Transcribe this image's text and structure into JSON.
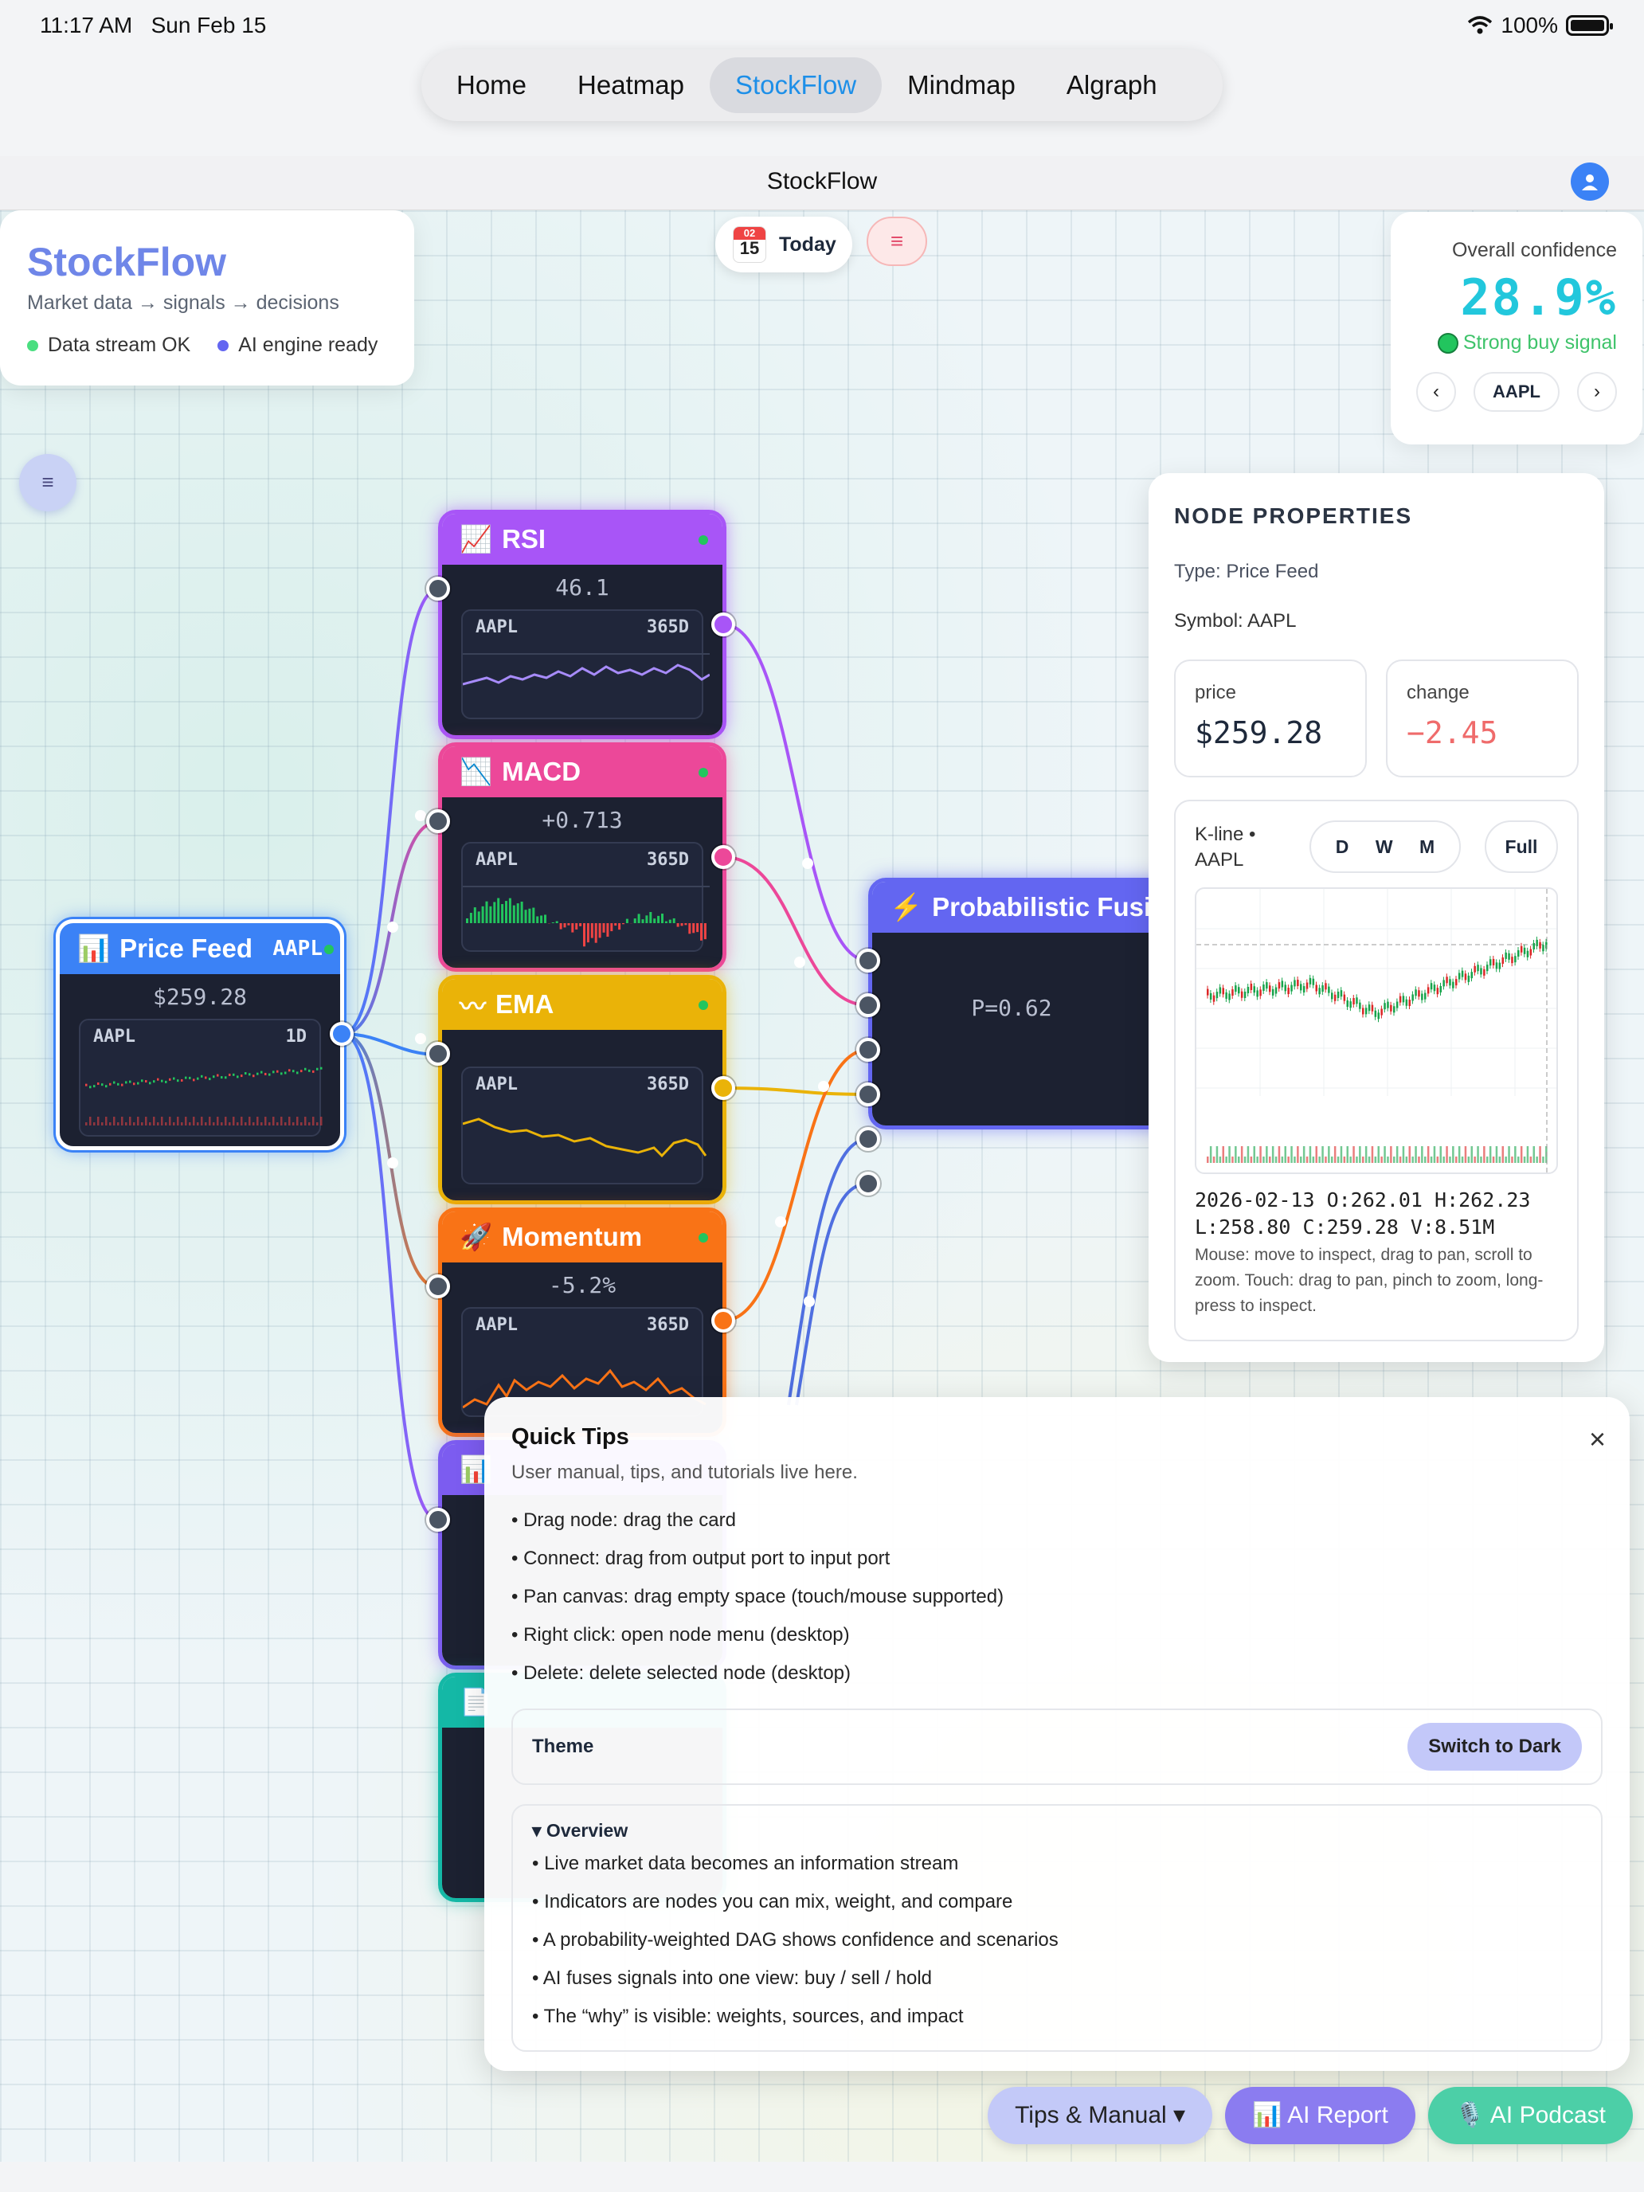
{
  "status": {
    "time": "11:17 AM",
    "date": "Sun Feb 15",
    "battery": "100%"
  },
  "nav": {
    "tabs": [
      "Home",
      "Heatmap",
      "StockFlow",
      "Mindmap",
      "Algraph"
    ],
    "active": "StockFlow"
  },
  "page_title": "StockFlow",
  "brand": {
    "name": "StockFlow",
    "tagline": "Market data → signals → decisions",
    "status_data": "Data stream OK",
    "status_ai": "AI engine ready"
  },
  "date_pill": {
    "month": "02",
    "day": "15",
    "label": "Today"
  },
  "confidence": {
    "label": "Overall confidence",
    "value": "28.9%",
    "signal": "Strong buy signal",
    "ticker": "AAPL",
    "prev": "‹",
    "next": "›"
  },
  "nodes": {
    "price_feed": {
      "icon": "📊",
      "title": "Price Feed",
      "symbol": "AAPL",
      "value": "$259.28",
      "chart_left": "AAPL",
      "chart_right": "1D"
    },
    "rsi": {
      "icon": "📈",
      "title": "RSI",
      "value": "46.1",
      "chart_left": "AAPL",
      "chart_right": "365D"
    },
    "macd": {
      "icon": "📉",
      "title": "MACD",
      "value": "+0.713",
      "chart_left": "AAPL",
      "chart_right": "365D"
    },
    "ema": {
      "icon": "〰",
      "title": "EMA",
      "chart_left": "AAPL",
      "chart_right": "365D"
    },
    "momentum": {
      "icon": "🚀",
      "title": "Momentum",
      "value": "-5.2%",
      "chart_left": "AAPL",
      "chart_right": "365D"
    },
    "fusion": {
      "icon": "⚡",
      "title": "Probabilistic Fusion",
      "value": "P=0.62"
    }
  },
  "properties": {
    "title": "NODE PROPERTIES",
    "type_label": "Type: Price Feed",
    "symbol_label": "Symbol: AAPL",
    "price_label": "price",
    "price_value": "$259.28",
    "change_label": "change",
    "change_value": "−2.45",
    "kline_title": "K-line • AAPL",
    "periods": [
      "D",
      "W",
      "M"
    ],
    "full_label": "Full",
    "ohlc_line1": "2026-02-13  O:262.01 H:262.23",
    "ohlc_line2": "L:258.80 C:259.28  V:8.51M",
    "hint": "Mouse: move to inspect, drag to pan, scroll to zoom. Touch: drag to pan, pinch to zoom, long-press to inspect."
  },
  "tips": {
    "title": "Quick Tips",
    "subtitle": "User manual, tips, and tutorials live here.",
    "items": [
      "Drag node: drag the card",
      "Connect: drag from output port to input port",
      "Pan canvas: drag empty space (touch/mouse supported)",
      "Right click: open node menu (desktop)",
      "Delete: delete selected node (desktop)"
    ],
    "theme_label": "Theme",
    "theme_button": "Switch to Dark",
    "overview_title": "▾ Overview",
    "overview": [
      "Live market data becomes an information stream",
      "Indicators are nodes you can mix, weight, and compare",
      "A probability-weighted DAG shows confidence and scenarios",
      "AI fuses signals into one view: buy / sell / hold",
      "The “why” is visible: weights, sources, and impact"
    ],
    "close": "×"
  },
  "bottom": {
    "tips": "Tips & Manual ▾",
    "report": "📊 AI Report",
    "podcast": "🎙️ AI Podcast"
  },
  "colors": {
    "rsi": "#a855f7",
    "macd": "#ec4899",
    "ema": "#eab308",
    "momentum": "#f97316",
    "fusion": "#6366f1",
    "price": "#3b82f6",
    "accent": "#1d8fe8"
  }
}
